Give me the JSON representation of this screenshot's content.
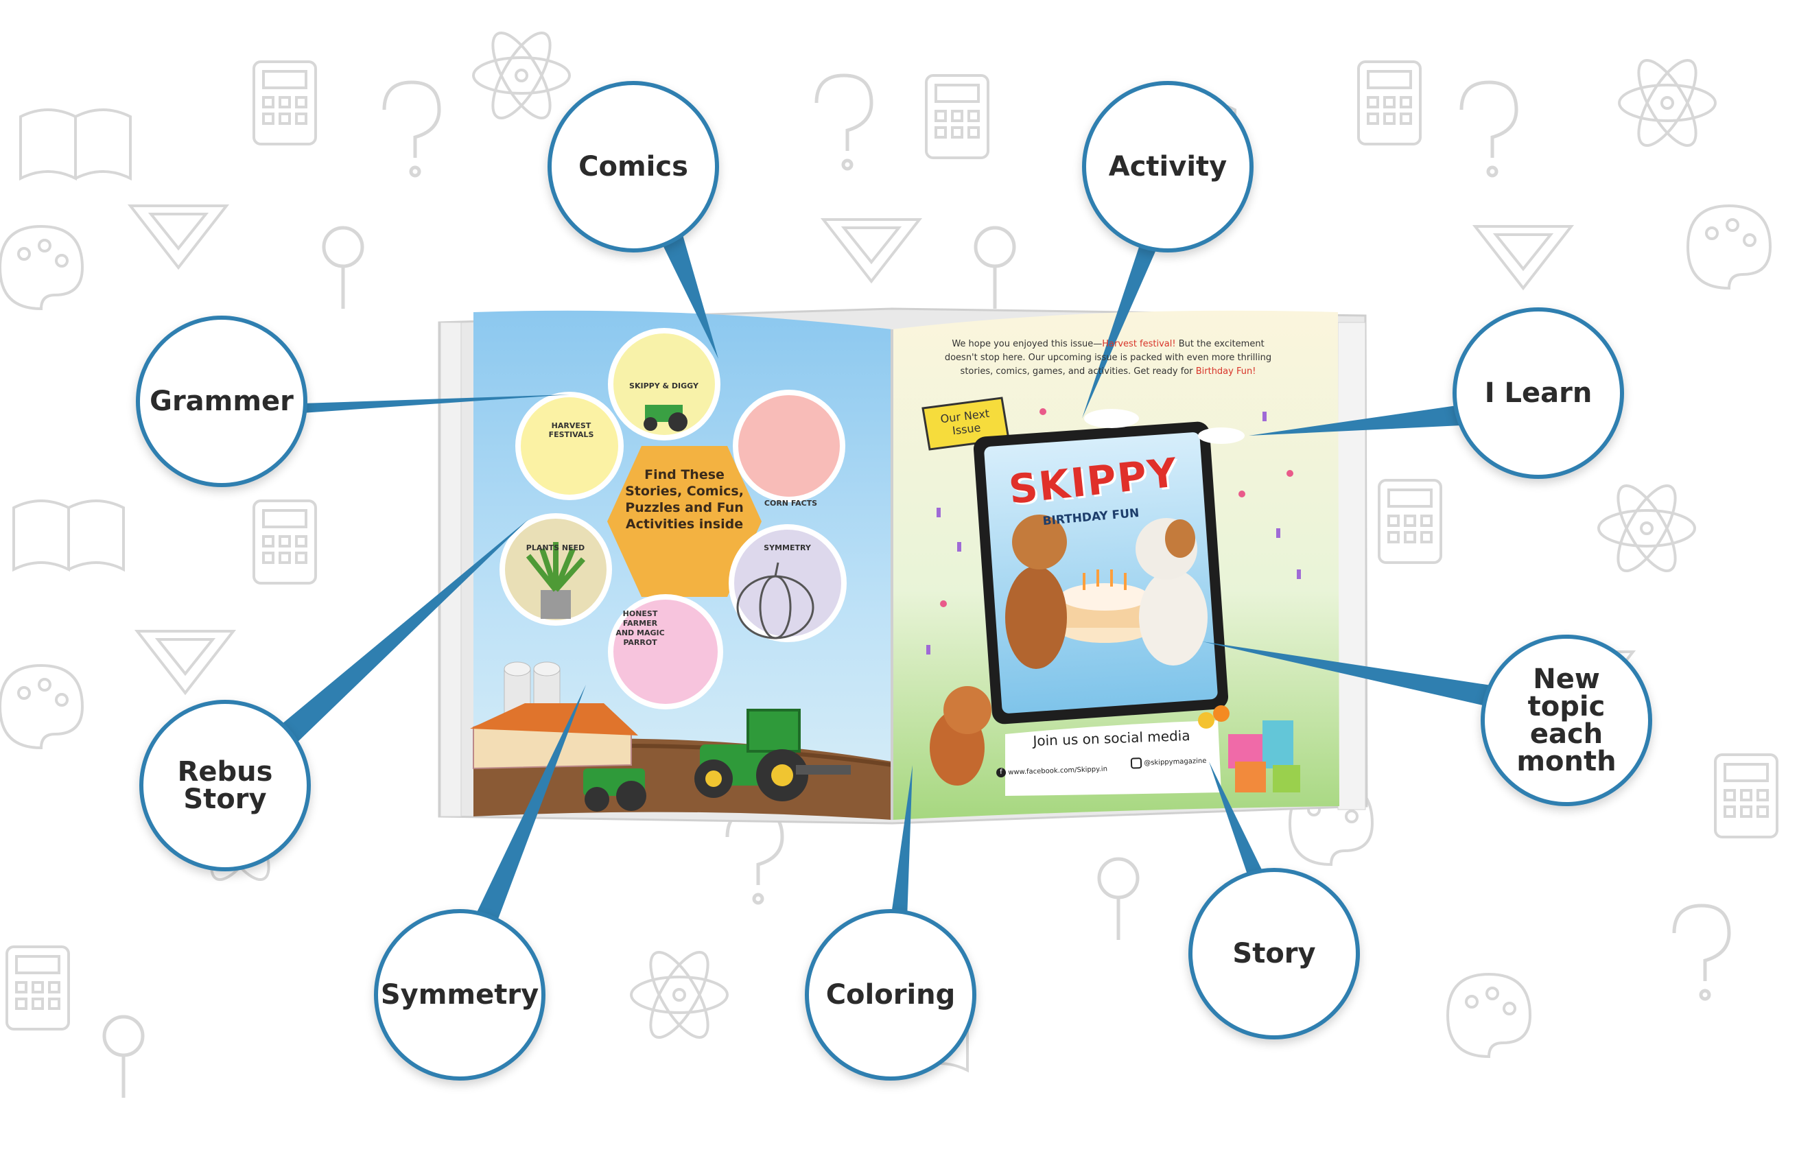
{
  "callouts": {
    "comics": "Comics",
    "activity": "Activity",
    "grammer": "Grammer",
    "ilearn": "I Learn",
    "rebus": "Rebus\nStory",
    "new_topic": "New topic\neach\nmonth",
    "symmetry": "Symmetry",
    "coloring": "Coloring",
    "story": "Story"
  },
  "left_page": {
    "center_text": "Find These Stories, Comics, Puzzles and Fun Activities inside",
    "bubbles": {
      "skippy_diggy": "SKIPPY & DIGGY",
      "harvest": "HARVEST FESTIVALS",
      "corn": "CORN FACTS",
      "plants": "PLANTS NEED",
      "symmetry": "SYMMETRY",
      "farmer": "HONEST FARMER AND MAGIC PARROT"
    }
  },
  "right_page": {
    "intro_1": "We hope you enjoyed this issue—",
    "intro_highlight": "Harvest festival!",
    "intro_2": " But the excitement doesn't stop here. Our upcoming issue is packed with even more thrilling stories, comics, games, and activities. Get ready for ",
    "intro_highlight_2": "Birthday Fun!",
    "next_issue_label": "Our Next Issue",
    "cover_title": "SKIPPY",
    "cover_subtitle": "BIRTHDAY FUN",
    "social_heading": "Join us on social media",
    "facebook": "www.facebook.com/Skippy.in",
    "instagram": "@skippymagazine"
  },
  "colors": {
    "callout_border": "#2f7fb0",
    "callout_text": "#2b2b2b",
    "title_red": "#e0302a",
    "highlight_red": "#d8352a"
  }
}
